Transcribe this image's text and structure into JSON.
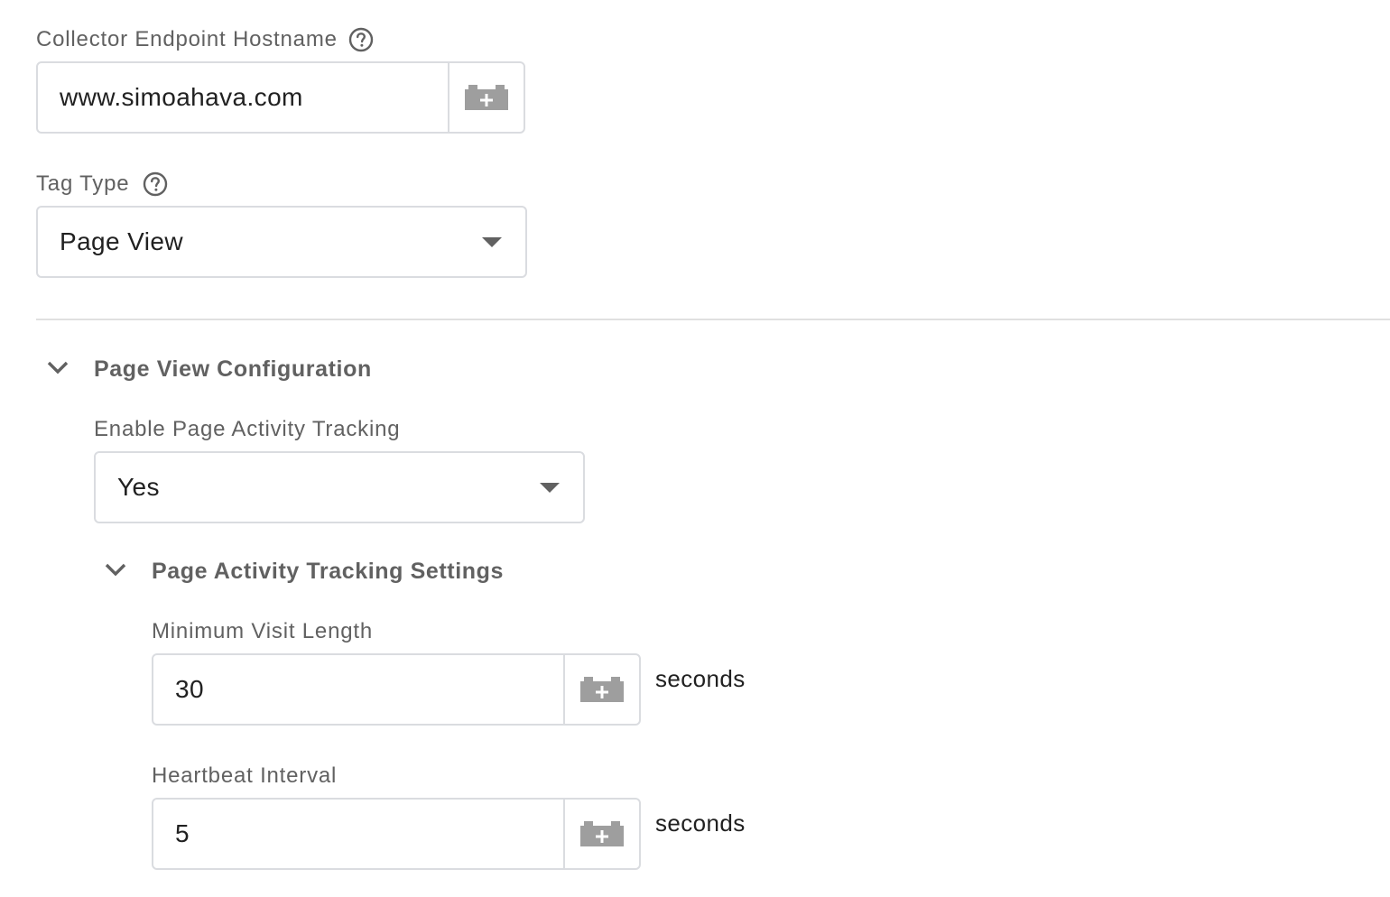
{
  "collector": {
    "label": "Collector Endpoint Hostname",
    "value": "www.simoahava.com",
    "help_icon": "help-circle-icon",
    "variable_icon": "variable-brick-icon"
  },
  "tag_type": {
    "label": "Tag Type",
    "selected": "Page View",
    "help_icon": "help-circle-icon"
  },
  "page_view_config": {
    "title": "Page View Configuration",
    "enable_activity": {
      "label": "Enable Page Activity Tracking",
      "selected": "Yes"
    },
    "activity_settings": {
      "title": "Page Activity Tracking Settings",
      "min_visit": {
        "label": "Minimum Visit Length",
        "value": "30",
        "suffix": "seconds"
      },
      "heartbeat": {
        "label": "Heartbeat Interval",
        "value": "5",
        "suffix": "seconds"
      }
    }
  },
  "colors": {
    "label": "#616161",
    "text": "#212121",
    "border": "#dadce0",
    "icon": "#9e9e9e"
  }
}
